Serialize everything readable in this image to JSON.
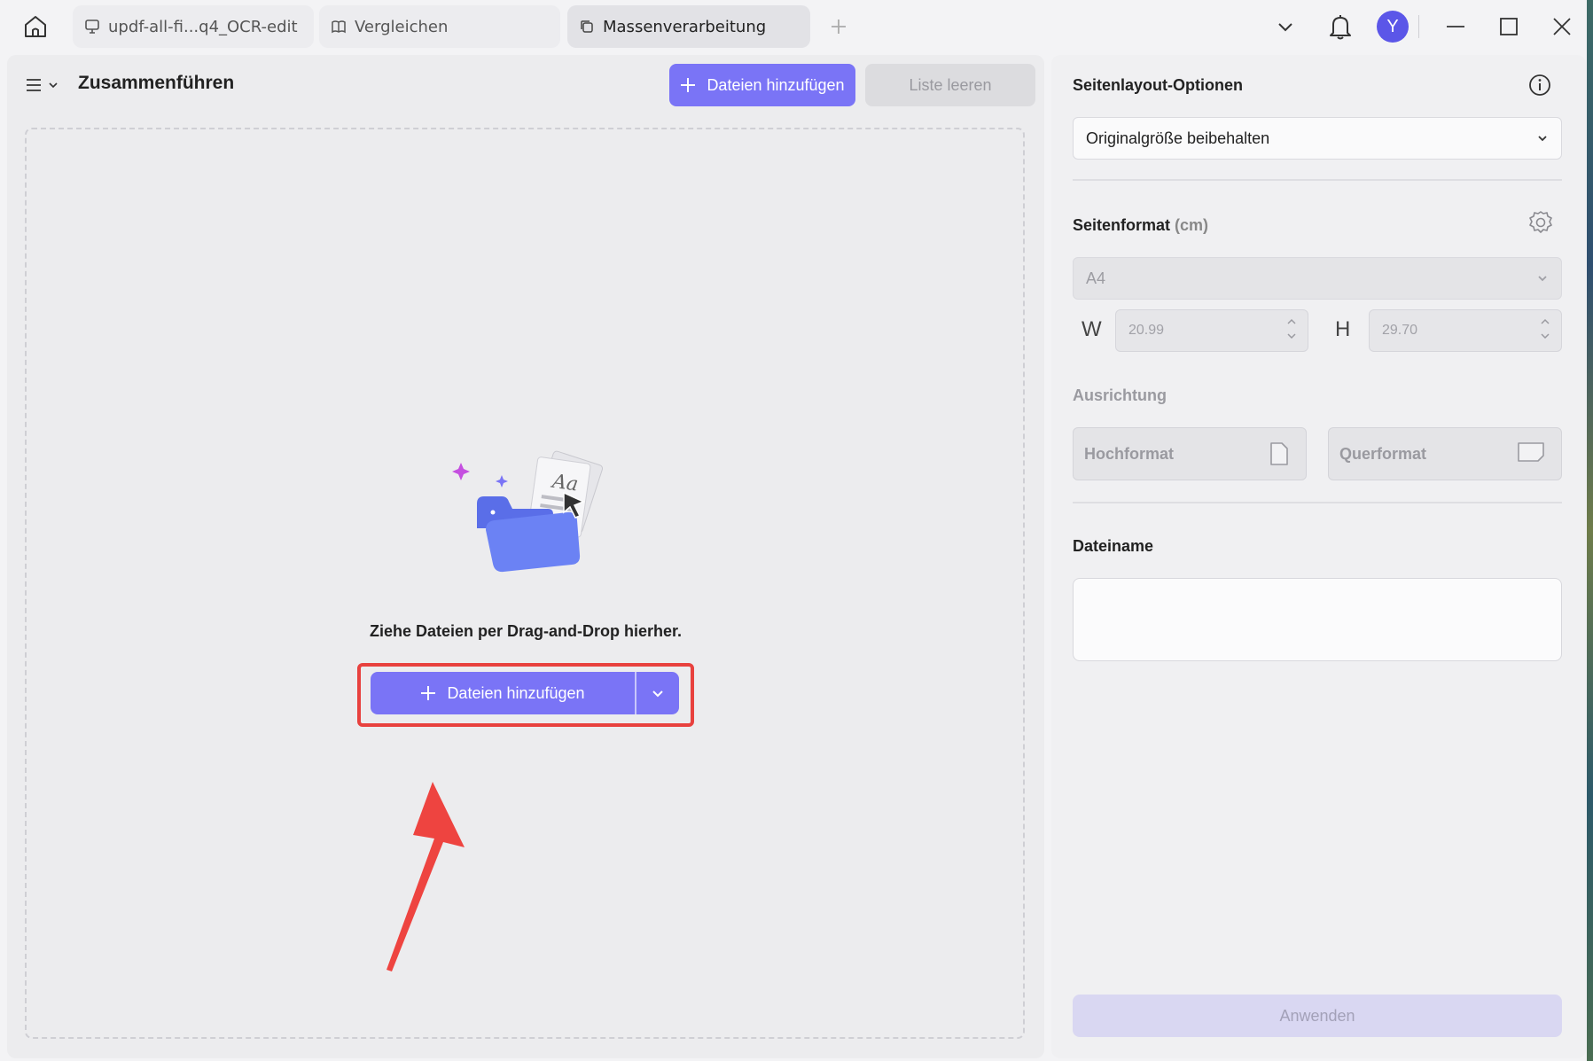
{
  "titlebar": {
    "tabs": [
      {
        "label": "updf-all-fi...q4_OCR-edit",
        "icon": "presentation-icon"
      },
      {
        "label": "Vergleichen",
        "icon": "book-icon"
      },
      {
        "label": "Massenverarbeitung",
        "icon": "copy-icon",
        "active": true
      }
    ],
    "avatar_letter": "Y"
  },
  "left": {
    "title": "Zusammenführen",
    "add_files_label": "Dateien hinzufügen",
    "clear_list_label": "Liste leeren",
    "drop_text": "Ziehe Dateien per Drag-and-Drop hierher.",
    "drop_add_files_label": "Dateien hinzufügen"
  },
  "right": {
    "layout_title": "Seitenlayout-Optionen",
    "layout_value": "Originalgröße beibehalten",
    "format_title": "Seitenformat",
    "format_unit": "(cm)",
    "format_value": "A4",
    "width_label": "W",
    "width_value": "20.99",
    "height_label": "H",
    "height_value": "29.70",
    "orientation_title": "Ausrichtung",
    "portrait_label": "Hochformat",
    "landscape_label": "Querformat",
    "filename_title": "Dateiname",
    "filename_value": "",
    "apply_label": "Anwenden"
  },
  "colors": {
    "accent": "#7a74f6",
    "avatar": "#5b56e8",
    "highlight": "#e8413e"
  }
}
